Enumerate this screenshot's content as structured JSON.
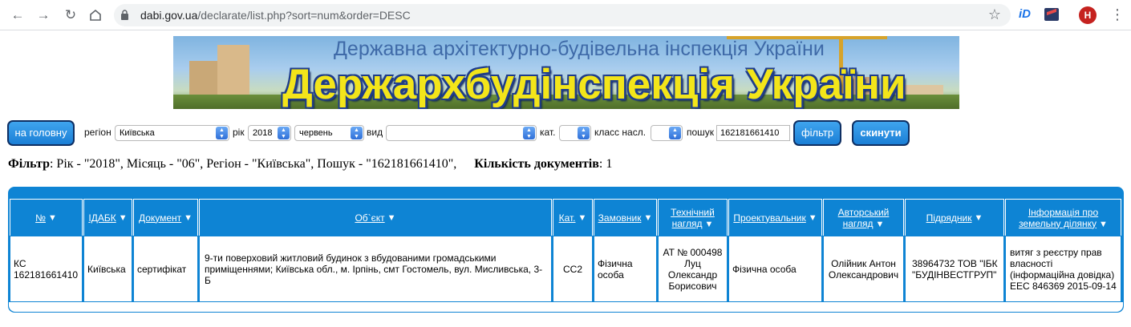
{
  "browser": {
    "url_domain": "dabi.gov.ua",
    "url_path": "/declarate/list.php?sort=num&order=DESC",
    "extension_1": "iD",
    "avatar_letter": "H"
  },
  "banner": {
    "subtitle": "Державна архітектурно-будівельна інспекція України",
    "title": "Держархбудінспекція України"
  },
  "filters": {
    "home_button": "на головну",
    "region_label": "регіон",
    "region_value": "Київська",
    "year_label": "рік",
    "year_value": "2018",
    "month_value": "червень",
    "type_label": "вид",
    "type_value": "",
    "category_label": "кат.",
    "category_value": "",
    "consequence_label": "класс насл.",
    "consequence_value": "",
    "search_label": "пошук",
    "search_value": "162181661410",
    "filter_button": "фільтр",
    "reset_button": "скинути"
  },
  "summary": {
    "filter_label": "Фільтр",
    "filter_text": ": Рік - \"2018\", Місяць - \"06\", Регіон - \"Київська\", Пошук - \"162181661410\",",
    "count_label": "Кількість документів",
    "count_value": ": 1"
  },
  "table": {
    "headers": {
      "num": "№",
      "idabk": "ІДАБК",
      "document": "Документ",
      "object": "Об`єкт",
      "category": "Кат.",
      "customer": "Замовник",
      "tech_line1": "Технічний",
      "tech_line2": "нагляд",
      "designer": "Проектувальник",
      "author_line1": "Авторський",
      "author_line2": "нагляд",
      "contractor": "Підрядник",
      "land_line1": "Інформація про",
      "land_line2": "земельну ділянку"
    },
    "row": {
      "num": "КС 162181661410",
      "idabk": "Київська",
      "document": "сертифікат",
      "object": "9-ти поверховий житловий будинок з вбудованими громадськими приміщеннями; Київська обл., м. Ірпінь, смт Гостомель, вул. Мисливська, 3-Б",
      "category": "СС2",
      "customer": "Фізична особа",
      "tech": "АТ № 000498 Луц Олександр Борисович",
      "designer": "Фізична особа",
      "author": "Олійник Антон Олександрович",
      "contractor": "38964732 ТОВ \"ІБК \"БУДІНВЕСТГРУП\"",
      "land": "витяг з реєстру прав власності (інформаційна довідка) ЕЕС 846369 2015-09-14"
    }
  },
  "colors": {
    "table_blue": "#0e84d4",
    "button_blue": "#1b7fd6",
    "banner_title": "#f3e51a"
  }
}
